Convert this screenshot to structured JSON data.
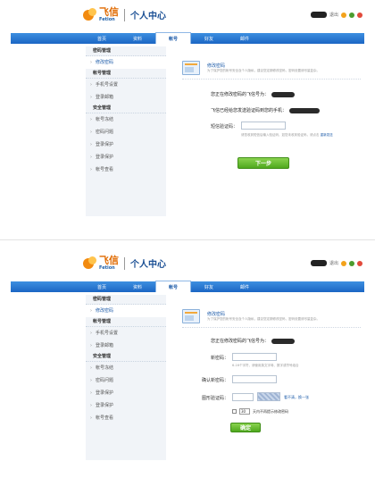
{
  "header": {
    "brand_cn": "飞信",
    "brand_en": "Fetion",
    "title": "个人中心",
    "user_menu": "退出"
  },
  "nav": {
    "tabs": [
      "首页",
      "资料",
      "帐号",
      "好友",
      "邮件"
    ],
    "active_index": 2
  },
  "sidebar": {
    "sections": [
      {
        "title": "密码管理",
        "items": [
          "修改密码"
        ]
      },
      {
        "title": "帐号管理",
        "items": [
          "手机号设置",
          "登录邮箱"
        ]
      },
      {
        "title": "安全管理",
        "items": [
          "帐号冻结",
          "密码问题",
          "登录保护",
          "登录保护",
          "帐号查看"
        ]
      }
    ],
    "selected_item": "修改密码"
  },
  "shot1": {
    "section_title": "修改密码",
    "section_desc": "为了保护您的帐号安全及个人隐私，建议您定期修改密码，密码设置请尽量复杂。",
    "line1_prefix": "您正在修改密码的飞信号为：",
    "line2_prefix": "飞信已经给您发送验证码到您的手机：",
    "code_label": "短信验证码：",
    "code_value": "",
    "hint": "请您收到短信后输入验证码，如您未收到验证码，请点击",
    "hint_link": "重新发送",
    "next_button": "下一步"
  },
  "shot2": {
    "section_title": "修改密码",
    "section_desc": "为了保护您的帐号安全及个人隐私，建议您定期修改密码，密码设置请尽量复杂。",
    "line1_prefix": "您正在修改密码的飞信号为：",
    "new_pwd_label": "新密码：",
    "new_pwd_hint": "6-16个字符，请使用英文字母、数字或符号组合",
    "confirm_pwd_label": "确认新密码：",
    "captcha_label": "图形验证码：",
    "captcha_refresh": "看不清，换一张",
    "remember_select": "30",
    "remember_text": "天内不再提示修改密码",
    "confirm_button": "确定"
  }
}
